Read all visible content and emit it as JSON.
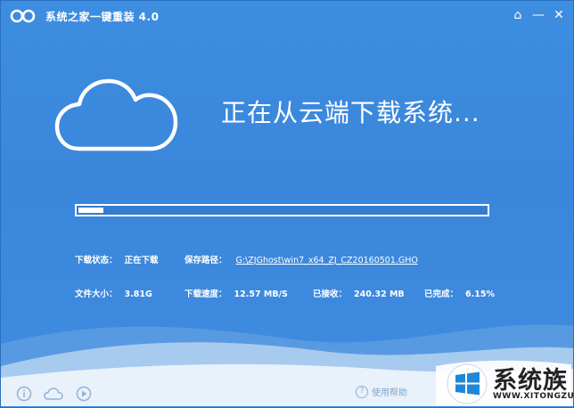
{
  "window": {
    "title": "系统之家一键重装 4.0",
    "accent_color": "#3d8de0"
  },
  "titlebar": {
    "home_glyph": "⌂",
    "minimize_glyph": "—",
    "close_glyph": "✕"
  },
  "main": {
    "headline": "正在从云端下载系统..."
  },
  "progress": {
    "value": 0.0615
  },
  "details": {
    "status_label": "下载状态：",
    "status_value": "正在下载",
    "save_path_label": "保存路径：",
    "save_path_value": "G:\\ZJGhost\\win7_x64_ZJ_CZ20160501.GHO",
    "file_size_label": "文件大小：",
    "file_size_value": "3.81G",
    "speed_label": "下载速度：",
    "speed_value": "12.57 MB/S",
    "received_label": "已接收：",
    "received_value": "240.32 MB",
    "completed_label": "已完成：",
    "completed_value": "6.15%"
  },
  "footer": {
    "icons": [
      "info-icon",
      "cloud-icon",
      "play-icon"
    ],
    "help_glyph": "?",
    "help_label": "使用帮助"
  },
  "watermark": {
    "name": "系统族",
    "url": "WWW.XITONGZU.COM"
  }
}
